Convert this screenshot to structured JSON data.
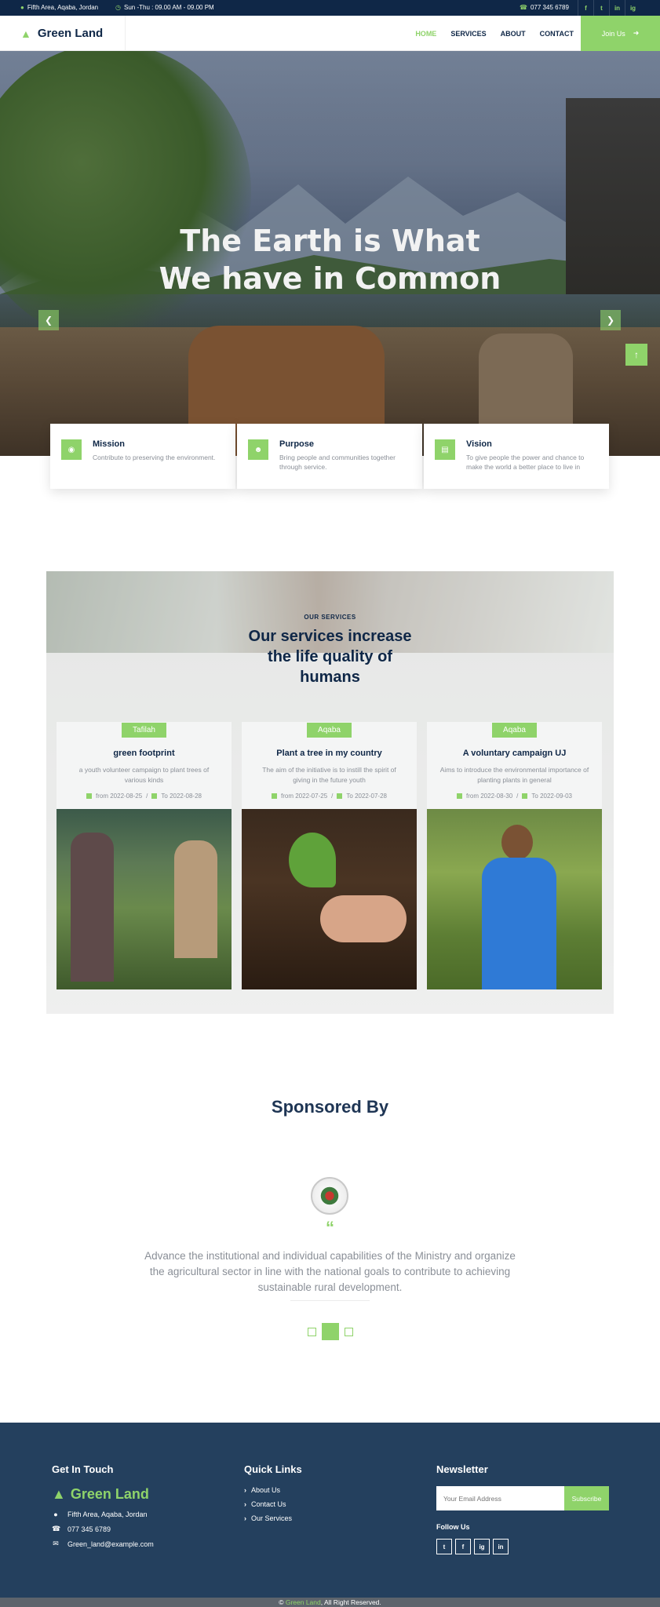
{
  "topbar": {
    "address": "Fifth Area, Aqaba, Jordan",
    "hours": "Sun -Thu : 09.00 AM - 09.00 PM",
    "phone": "077 345 6789",
    "social": [
      "f",
      "t",
      "in",
      "ig"
    ]
  },
  "nav": {
    "brand": "Green Land",
    "links": [
      "HOME",
      "SERVICES",
      "ABOUT",
      "CONTACT"
    ],
    "active": "HOME",
    "join": "Join Us"
  },
  "hero": {
    "title_line1": "The Earth is What",
    "title_line2": "We have in Common"
  },
  "features": [
    {
      "title": "Mission",
      "text": "Contribute to preserving the environment.",
      "icon": "target-icon"
    },
    {
      "title": "Purpose",
      "text": "Bring people and communities together through service.",
      "icon": "people-icon"
    },
    {
      "title": "Vision",
      "text": "To give people the power and chance to make the world a better place to live in",
      "icon": "document-icon"
    }
  ],
  "services": {
    "kicker": "OUR SERVICES",
    "title_line1": "Our services increase",
    "title_line2": "the life quality of",
    "title_line3": "humans",
    "cards": [
      {
        "tag": "Tafilah",
        "title": "green footprint",
        "text": "a youth volunteer campaign to plant trees of various kinds",
        "from": "from 2022-08-25",
        "to": "To 2022-08-28"
      },
      {
        "tag": "Aqaba",
        "title": "Plant a tree in my country",
        "text": "The aim of the initiative is to instill the spirit of giving in the future youth",
        "from": "from 2022-07-25",
        "to": "To 2022-07-28"
      },
      {
        "tag": "Aqaba",
        "title": "A voluntary campaign UJ",
        "text": "Aims to introduce the environmental importance of planting plants in general",
        "from": "from 2022-08-30",
        "to": "To 2022-09-03"
      }
    ]
  },
  "sponsors": {
    "title": "Sponsored By",
    "quote_mark": "“",
    "text": "Advance the institutional and individual capabilities of the Ministry and organize the agricultural sector in line with the national goals to contribute to achieving sustainable rural development."
  },
  "footer": {
    "contact_title": "Get In Touch",
    "brand": "Green Land",
    "address": "Fifth Area, Aqaba, Jordan",
    "phone": "077 345 6789",
    "email": "Green_land@example.com",
    "links_title": "Quick Links",
    "links": [
      "About Us",
      "Contact Us",
      "Our Services"
    ],
    "newsletter_title": "Newsletter",
    "email_placeholder": "Your Email Address",
    "subscribe": "Subscribe",
    "follow": "Follow Us",
    "copyright_prefix": "© ",
    "copyright_brand": "Green Land",
    "copyright_suffix": ", All Right Reserved."
  },
  "colors": {
    "accent": "#8fd36a",
    "navy": "#0f2747",
    "footer": "#24405e"
  }
}
